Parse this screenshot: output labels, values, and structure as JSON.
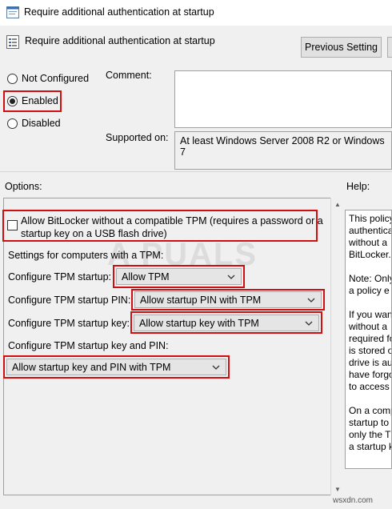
{
  "window": {
    "title": "Require additional authentication at startup"
  },
  "header": {
    "policy_name": "Require additional authentication at startup",
    "previous_button": "Previous Setting",
    "next_button": ""
  },
  "state": {
    "options": [
      {
        "label": "Not Configured",
        "selected": false
      },
      {
        "label": "Enabled",
        "selected": true
      },
      {
        "label": "Disabled",
        "selected": false
      }
    ]
  },
  "comment": {
    "label": "Comment:",
    "value": ""
  },
  "supported": {
    "label": "Supported on:",
    "value": "At least Windows Server 2008 R2 or Windows 7"
  },
  "sections": {
    "options_label": "Options:",
    "help_label": "Help:"
  },
  "options": {
    "allow_bitlocker_checkbox": {
      "line1": "Allow BitLocker without a compatible TPM (requires a password or a",
      "line2": "startup key on a USB flash drive)",
      "checked": false
    },
    "settings_label": "Settings for computers with a TPM:",
    "tpm_startup": {
      "label": "Configure TPM startup:",
      "value": "Allow TPM"
    },
    "tpm_startup_pin": {
      "label": "Configure TPM startup PIN:",
      "value": "Allow startup PIN with TPM"
    },
    "tpm_startup_key": {
      "label": "Configure TPM startup key:",
      "value": "Allow startup key with TPM"
    },
    "tpm_key_and_pin": {
      "label": "Configure TPM startup key and PIN:",
      "value": "Allow startup key and PIN with TPM"
    }
  },
  "help": {
    "lines": [
      "This policy",
      "authentica",
      "without a",
      "BitLocker.",
      "",
      "Note: Only",
      "a policy e",
      "",
      "If you wan",
      "without a",
      "required fo",
      "is stored o",
      "drive is au",
      "have forgo",
      "to access t",
      "",
      "On a comp",
      "startup to",
      "only the T",
      "a startup k"
    ]
  },
  "watermark": "A PUALS",
  "footer": "wsxdn.com",
  "colors": {
    "highlight": "#d01010",
    "background": "#f0f0f0"
  }
}
